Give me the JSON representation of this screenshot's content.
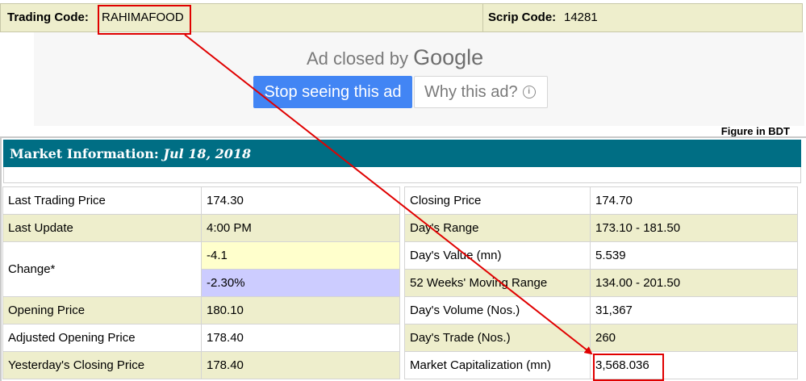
{
  "codes": {
    "trading_code_label": "Trading Code:",
    "trading_code_value": "RAHIMAFOOD",
    "scrip_code_label": "Scrip Code:",
    "scrip_code_value": "14281"
  },
  "ad": {
    "closed_text": "Ad closed by",
    "brand": "Google",
    "stop_button": "Stop seeing this ad",
    "why_button": "Why this ad?"
  },
  "figure_note": "Figure in BDT",
  "market_info": {
    "title": "Market Information:",
    "date": "Jul 18, 2018"
  },
  "left_table": {
    "last_trading_price_label": "Last Trading Price",
    "last_trading_price": "174.30",
    "last_update_label": "Last Update",
    "last_update": "4:00 PM",
    "change_label": "Change*",
    "change_value": "-4.1",
    "change_percent": "-2.30%",
    "opening_price_label": "Opening Price",
    "opening_price": "180.10",
    "adjusted_opening_price_label": "Adjusted Opening Price",
    "adjusted_opening_price": "178.40",
    "yesterday_closing_label": "Yesterday's Closing Price",
    "yesterday_closing": "178.40"
  },
  "right_table": {
    "closing_price_label": "Closing Price",
    "closing_price": "174.70",
    "days_range_label": "Day's Range",
    "days_range": "173.10 - 181.50",
    "days_value_label": "Day's Value (mn)",
    "days_value": "5.539",
    "moving_range_label": "52 Weeks' Moving Range",
    "moving_range": "134.00 - 201.50",
    "days_volume_label": "Day's Volume (Nos.)",
    "days_volume": "31,367",
    "days_trade_label": "Day's Trade (Nos.)",
    "days_trade": "260",
    "market_cap_label": "Market Capitalization (mn)",
    "market_cap": "3,568.036"
  },
  "colors": {
    "header_teal": "#006e84",
    "row_shade": "#eeeecc",
    "change_yellow": "#ffffcc",
    "change_blue": "#ccccff",
    "annotation_red": "#e00000",
    "google_blue": "#4285f4"
  }
}
